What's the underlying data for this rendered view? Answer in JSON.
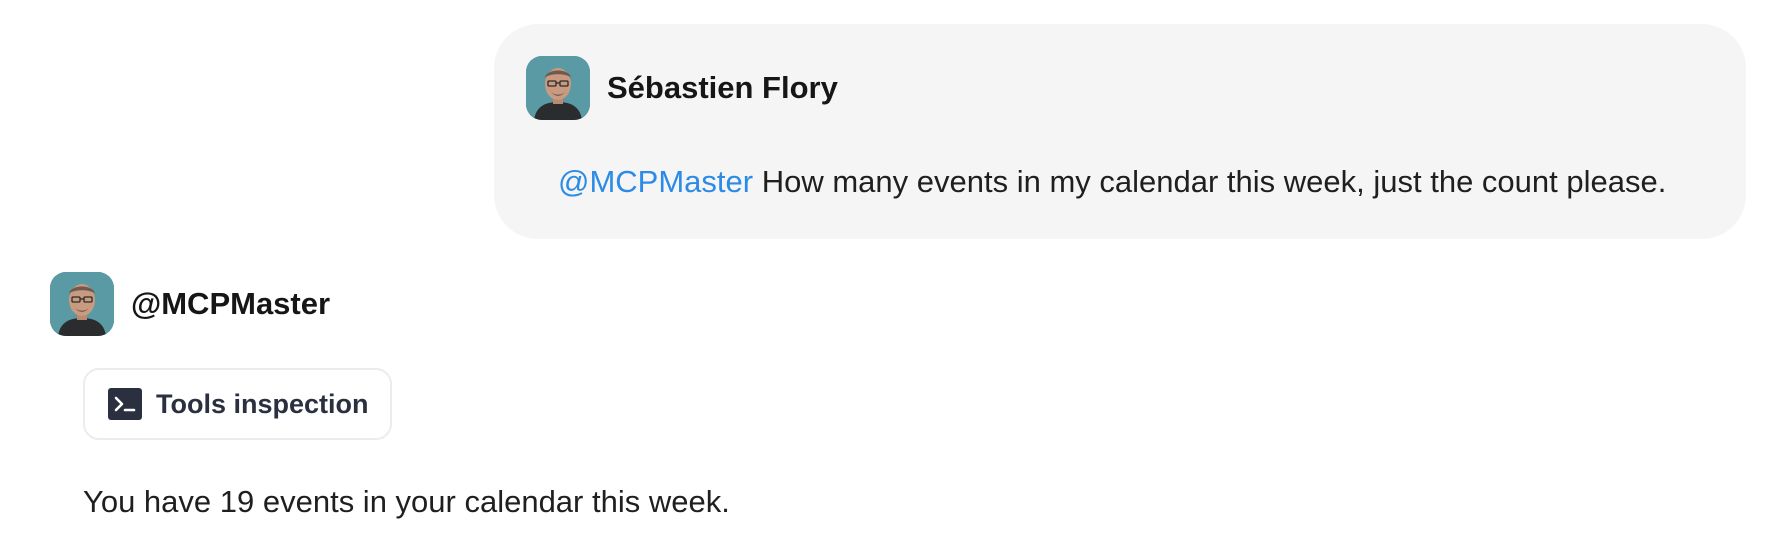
{
  "user_message": {
    "author": "Sébastien Flory",
    "mention": "@MCPMaster",
    "text": " How many events in my calendar this week, just the count please.",
    "bubble_color": "#f5f5f5",
    "mention_color": "#2b8be6"
  },
  "assistant_message": {
    "author": "@MCPMaster",
    "tools_button_label": "Tools inspection",
    "tools_icon": "terminal-icon",
    "reply": "You have 19 events in your calendar this week."
  },
  "avatar_icon": "person-avatar"
}
